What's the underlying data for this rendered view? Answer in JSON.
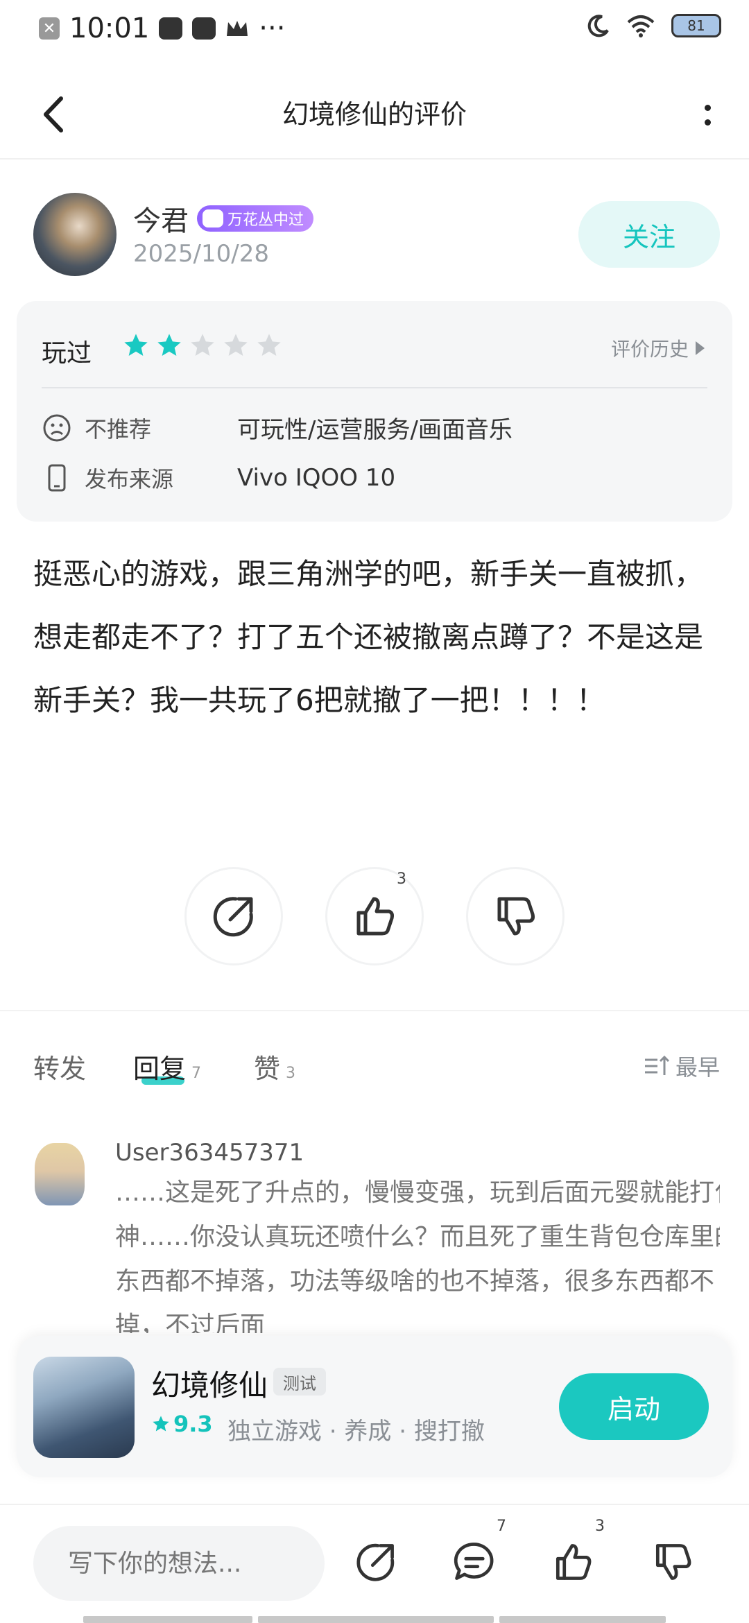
{
  "status_bar": {
    "time": "10:01",
    "more": "···",
    "battery": "81"
  },
  "header": {
    "title": "幻境修仙的评价"
  },
  "author": {
    "name": "今君",
    "badge": "万花丛中过",
    "date": "2025/10/28",
    "follow_label": "关注"
  },
  "rating_card": {
    "played_label": "玩过",
    "stars_filled": 2,
    "stars_total": 5,
    "star_color": "#19c9c2",
    "history_label": "评价历史",
    "recommend_label": "不推荐",
    "recommend_value": "可玩性/运营服务/画面音乐",
    "source_label": "发布来源",
    "source_value": "Vivo IQOO 10"
  },
  "review": {
    "text": "挺恶心的游戏，跟三角洲学的吧，新手关一直被抓，想走都走不了？打了五个还被撤离点蹲了？不是这是新手关？我一共玩了6把就撤了一把！！！！"
  },
  "actions": {
    "like_count": "3"
  },
  "tabs": {
    "items": [
      {
        "label": "转发",
        "count": ""
      },
      {
        "label": "回复",
        "count": "7"
      },
      {
        "label": "赞",
        "count": "3"
      }
    ],
    "sort_label": "最早"
  },
  "reply": {
    "username": "User363457371",
    "text": "……这是死了升点的，慢慢变强，玩到后面元婴就能打化神……你没认真玩还喷什么？而且死了重生背包仓库里的东西都不掉落，功法等级啥的也不掉落，很多东西都不掉，不过后面"
  },
  "game_card": {
    "name": "幻境修仙",
    "tag": "测试",
    "score": "9.3",
    "meta": "独立游戏 · 养成 · 搜打撤",
    "launch_label": "启动",
    "accent": "#1bc8c0"
  },
  "bottom_bar": {
    "input_placeholder": "写下你的想法...",
    "comment_count": "7",
    "like_count": "3"
  }
}
